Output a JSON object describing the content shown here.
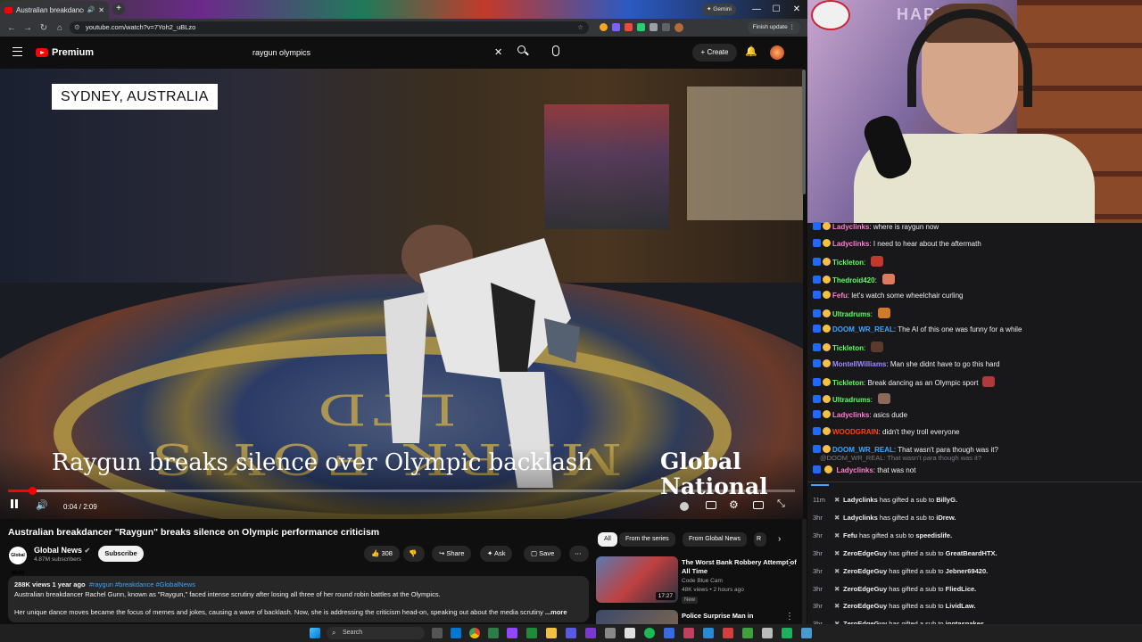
{
  "browser": {
    "tab_title": "Australian breakdancer \"R...",
    "url": "youtube.com/watch?v=7Yoh2_uBLzo",
    "update_label": "Finish update",
    "profile_label": "Gemini"
  },
  "youtube": {
    "brand": "Premium",
    "search_value": "raygun olympics",
    "create_label": "Create"
  },
  "video": {
    "location_banner": "SYDNEY, AUSTRALIA",
    "headline": "Raygun breaks silence over Olympic backlash",
    "brand_line1": "Global",
    "brand_line2": "National",
    "time": "0:04 / 2:09",
    "progress_fraction": 0.031
  },
  "details": {
    "title": "Australian breakdancer \"Raygun\" breaks silence on Olympic performance criticism",
    "channel_avatar_text": "Global NEWS",
    "channel": "Global News",
    "subscribers": "4.87M subscribers",
    "subscribe": "Subscribe",
    "likes": "308",
    "share": "Share",
    "ask": "Ask",
    "save": "Save",
    "views_meta": "288K views  1 year ago",
    "tags": "#raygun #breakdance #GlobalNews",
    "desc_line1": "Australian breakdancer Rachel Gunn, known as \"Raygun,\" faced intense scrutiny after losing all three of her round robin battles at the Olympics.",
    "desc_line2": "Her unique dance moves became the focus of memes and jokes, causing a wave of backlash. Now, she is addressing the criticism head-on, speaking out about the media scrutiny",
    "more": "...more"
  },
  "recs": {
    "chips": [
      "All",
      "From the series",
      "From Global News",
      "R"
    ],
    "items": [
      {
        "title": "The Worst Bank Robbery Attempt of All Time",
        "channel": "Code Blue Cam",
        "meta": "48K views • 2 hours ago",
        "badge": "New",
        "duration": "17:27"
      },
      {
        "title": "Police Surprise Man in",
        "channel": "",
        "meta": "",
        "badge": "",
        "duration": ""
      }
    ]
  },
  "chat": {
    "messages": [
      {
        "user": "Ladyclinks",
        "color": "#ff7fd0",
        "text": "where is raygun now",
        "emote": ""
      },
      {
        "user": "Ladyclinks",
        "color": "#ff7fd0",
        "text": "I need to hear about the aftermath",
        "emote": ""
      },
      {
        "user": "Tickleton",
        "color": "#5cff5c",
        "text": "",
        "emote": "#c0392b"
      },
      {
        "user": "Thedroid420",
        "color": "#5cff5c",
        "text": "",
        "emote": "#e07a5f"
      },
      {
        "user": "Fefu",
        "color": "#ff7fd0",
        "text": "let's watch some wheelchair curling",
        "emote": ""
      },
      {
        "user": "Ultradrums",
        "color": "#5cff5c",
        "text": "",
        "emote": "#d17a2a"
      },
      {
        "user": "DOOM_WR_REAL",
        "color": "#3ea6ff",
        "text": "The AI of this one was funny for a while",
        "emote": ""
      },
      {
        "user": "Tickleton",
        "color": "#5cff5c",
        "text": "",
        "emote": "#5a3a2a"
      },
      {
        "user": "MontellWilliams",
        "color": "#9b8cff",
        "text": "Man she didnt have to go this hard",
        "emote": ""
      },
      {
        "user": "Tickleton",
        "color": "#5cff5c",
        "text": "Break dancing as an Olympic sport",
        "emote": "#b03a3a"
      },
      {
        "user": "Ultradrums",
        "color": "#5cff5c",
        "text": "",
        "emote": "#8a6a5a"
      },
      {
        "user": "Ladyclinks",
        "color": "#ff7fd0",
        "text": "asics dude",
        "emote": ""
      },
      {
        "user": "WOODGRAIN",
        "color": "#ff4500",
        "text": "didn't they troll everyone",
        "emote": ""
      },
      {
        "user": "DOOM_WR_REAL",
        "color": "#3ea6ff",
        "text": "That wasn't para though was it?",
        "emote": ""
      }
    ],
    "reply_context": "@DOOM_WR_REAL: That wasn't para though was it?",
    "last": {
      "user": "Ladyclinks",
      "color": "#ff7fd0",
      "text": "that was not"
    }
  },
  "gifts": {
    "rows": [
      {
        "ago": "11m",
        "gifter": "Ladyclinks",
        "verb": "has gifted a sub to",
        "to": "BillyG."
      },
      {
        "ago": "3hr",
        "gifter": "Ladyclinks",
        "verb": "has gifted a sub to",
        "to": "iDrew."
      },
      {
        "ago": "3hr",
        "gifter": "Fefu",
        "verb": "has gifted a sub to",
        "to": "speedislife."
      },
      {
        "ago": "3hr",
        "gifter": "ZeroEdgeGuy",
        "verb": "has gifted a sub to",
        "to": "GreatBeardHTX."
      },
      {
        "ago": "3hr",
        "gifter": "ZeroEdgeGuy",
        "verb": "has gifted a sub to",
        "to": "Jebner69420."
      },
      {
        "ago": "3hr",
        "gifter": "ZeroEdgeGuy",
        "verb": "has gifted a sub to",
        "to": "FliedLice."
      },
      {
        "ago": "3hr",
        "gifter": "ZeroEdgeGuy",
        "verb": "has gifted a sub to",
        "to": "LividLaw."
      },
      {
        "ago": "3hr",
        "gifter": "ZeroEdgeGuy",
        "verb": "has gifted a sub to",
        "to": "igotasnakes."
      }
    ]
  },
  "taskbar": {
    "search_placeholder": "Search"
  },
  "webcam": {
    "wall_text": "HAPPY EAS"
  }
}
